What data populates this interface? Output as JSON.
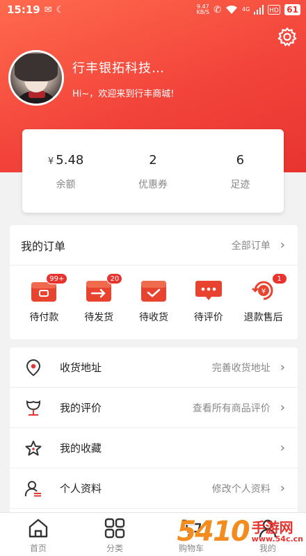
{
  "status_bar": {
    "time": "15:19",
    "network_speed_top": "9.47",
    "network_speed_unit": "KB/S",
    "signal_label": "4G",
    "battery": "61"
  },
  "profile": {
    "name": "行丰银拓科技…",
    "greeting": "Hi~，欢迎来到行丰商城!"
  },
  "stats": [
    {
      "currency": "¥",
      "value": "5.48",
      "label": "余额"
    },
    {
      "currency": "",
      "value": "2",
      "label": "优惠券"
    },
    {
      "currency": "",
      "value": "6",
      "label": "足迹"
    }
  ],
  "orders": {
    "title": "我的订单",
    "all_label": "全部订单",
    "items": [
      {
        "label": "待付款",
        "badge": "99+",
        "icon": "wallet-icon"
      },
      {
        "label": "待发货",
        "badge": "20",
        "icon": "box-arrow-icon"
      },
      {
        "label": "待收货",
        "badge": "",
        "icon": "box-check-icon"
      },
      {
        "label": "待评价",
        "badge": "",
        "icon": "chat-bubble-icon"
      },
      {
        "label": "退款售后",
        "badge": "1",
        "icon": "refund-icon"
      }
    ]
  },
  "menu": [
    {
      "label": "收货地址",
      "hint": "完善收货地址",
      "icon": "location-pin-icon"
    },
    {
      "label": "我的评价",
      "hint": "查看所有商品评价",
      "icon": "flower-icon"
    },
    {
      "label": "我的收藏",
      "hint": "",
      "icon": "star-icon"
    },
    {
      "label": "个人资料",
      "hint": "修改个人资料",
      "icon": "user-profile-icon"
    }
  ],
  "nav": [
    {
      "label": "首页",
      "icon": "home-icon"
    },
    {
      "label": "分类",
      "icon": "category-grid-icon"
    },
    {
      "label": "购物车",
      "icon": "cart-icon"
    },
    {
      "label": "我的",
      "icon": "user-icon"
    }
  ],
  "watermark": {
    "number": "54",
    "number2": "10",
    "text": "手游网",
    "url": "www.54c.cn"
  },
  "colors": {
    "accent": "#e8342f",
    "header_gradient_start": "#ff6a4d",
    "badge": "#e8342f",
    "watermark_orange": "#f28c1e"
  }
}
